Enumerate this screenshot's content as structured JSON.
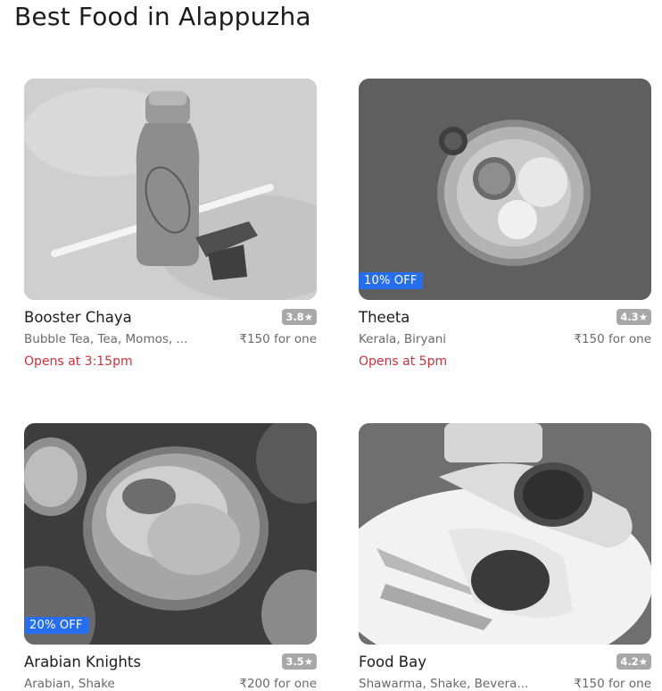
{
  "page": {
    "title": "Best Food in Alappuzha"
  },
  "restaurants": [
    {
      "name": "Booster Chaya",
      "rating": "3.8",
      "cuisines": "Bubble Tea, Tea, Momos, ...",
      "price": "₹150 for one",
      "opens": "Opens at 3:15pm",
      "offer": "",
      "image_icon": "milkshake-bottle-photo"
    },
    {
      "name": "Theeta",
      "rating": "4.3",
      "cuisines": "Kerala, Biryani",
      "price": "₹150 for one",
      "opens": "Opens at 5pm",
      "offer": "10% OFF",
      "image_icon": "thali-plate-photo"
    },
    {
      "name": "Arabian Knights",
      "rating": "3.5",
      "cuisines": "Arabian, Shake",
      "price": "₹200 for one",
      "opens": "",
      "offer": "20% OFF",
      "image_icon": "biryani-plate-photo"
    },
    {
      "name": "Food Bay",
      "rating": "4.2",
      "cuisines": "Shawarma, Shake, Bevera...",
      "price": "₹150 for one",
      "opens": "",
      "offer": "",
      "image_icon": "shawarma-roll-photo"
    }
  ],
  "colors": {
    "offer_badge": "#256fef",
    "opens_text": "#d0303a",
    "rating_badge": "#a8a8a8"
  }
}
